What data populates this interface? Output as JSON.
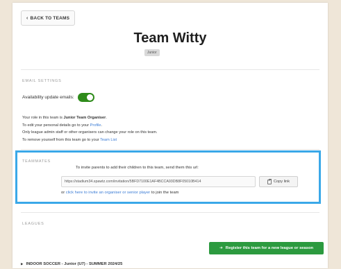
{
  "header": {
    "back_label": "BACK TO TEAMS",
    "title": "Team Witty",
    "role_badge": "Junior"
  },
  "email_settings": {
    "section_label": "EMAIL SETTINGS",
    "availability_label": "Availability update emails:",
    "availability_on": true
  },
  "role_info": {
    "line1_prefix": "Your role in this team is ",
    "role": "Junior Team Organiser",
    "line1_suffix": ".",
    "line2_prefix": "To edit your personal details go to your ",
    "line2_link": "Profile",
    "line2_suffix": ".",
    "line3": "Only league admin staff or other organisers can change your role on this team.",
    "line4_prefix": "To remove yourself from this team go to your ",
    "line4_link": "Team List"
  },
  "teammates": {
    "section_label": "TEAMMATES",
    "invite_text": "To invite parents to add their children to this team, send them this url:",
    "invite_url": "https://stadium34.spawtz.com/invitation/5BFD7100E1AF4BCCA93DB8F05010B414",
    "copy_label": "Copy link",
    "or_prefix": "or ",
    "organiser_link": "click here to invite an organiser or senior player",
    "or_suffix": " to join the team"
  },
  "leagues": {
    "section_label": "LEAGUES",
    "register_label": "Register this team for a new league or season",
    "items": [
      {
        "label": "INDOOR SOCCER - Junior (U7) - SUMMER 2024/25"
      }
    ]
  },
  "colors": {
    "accent_green": "#2c9a3f",
    "toggle_green": "#2e8b1a",
    "link_blue": "#3a7bd5",
    "highlight_blue": "#3aa8e8"
  }
}
